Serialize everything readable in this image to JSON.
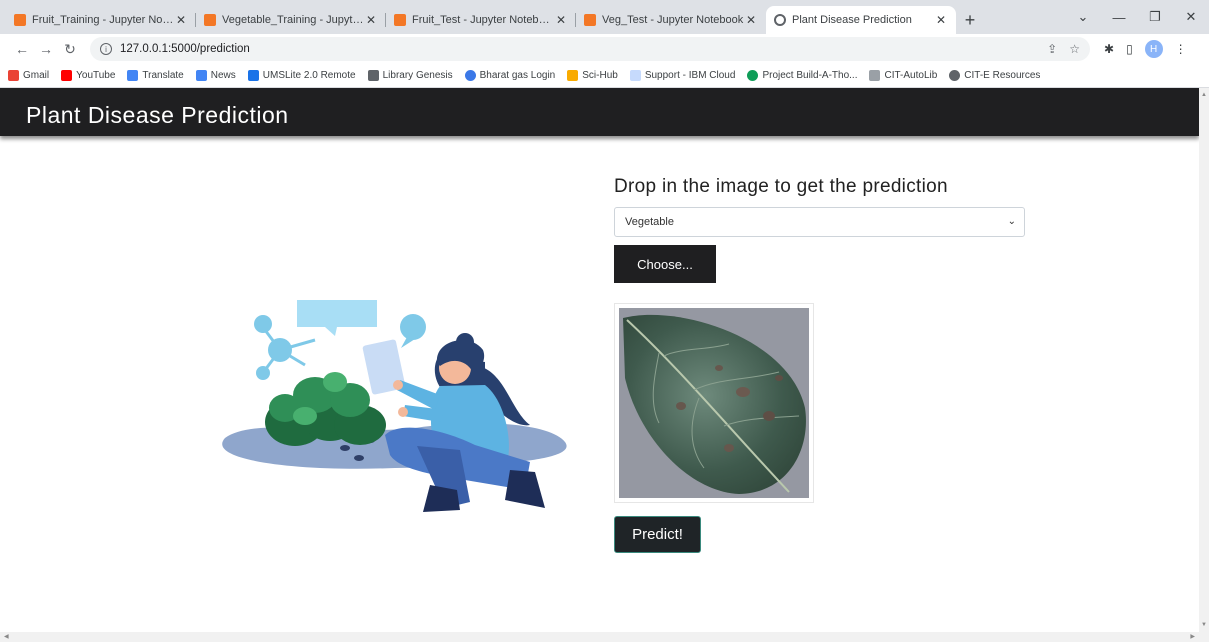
{
  "browser": {
    "tabs": [
      {
        "title": "Fruit_Training - Jupyter Notebook",
        "icon": "jupyter-icon",
        "active": false
      },
      {
        "title": "Vegetable_Training - Jupyter Notebook",
        "icon": "jupyter-icon",
        "active": false
      },
      {
        "title": "Fruit_Test - Jupyter Notebook",
        "icon": "jupyter-icon",
        "active": false
      },
      {
        "title": "Veg_Test - Jupyter Notebook",
        "icon": "jupyter-icon",
        "active": false
      },
      {
        "title": "Plant Disease Prediction",
        "icon": "globe-icon",
        "active": true
      }
    ],
    "url": "127.0.0.1:5000/prediction",
    "profile_initial": "H",
    "bookmarks": [
      {
        "label": "Gmail",
        "color": "#ea4335"
      },
      {
        "label": "YouTube",
        "color": "#ff0000"
      },
      {
        "label": "Translate",
        "color": "#4285f4"
      },
      {
        "label": "News",
        "color": "#4285f4"
      },
      {
        "label": "UMSLite 2.0 Remote",
        "color": "#1a73e8"
      },
      {
        "label": "Library Genesis",
        "color": "#5f6368"
      },
      {
        "label": "Bharat gas Login",
        "color": "#3b78e7"
      },
      {
        "label": "Sci-Hub",
        "color": "#f9ab00"
      },
      {
        "label": "Support - IBM Cloud",
        "color": "#c6dafc"
      },
      {
        "label": "Project Build-A-Tho...",
        "color": "#0f9d58"
      },
      {
        "label": "CIT-AutoLib",
        "color": "#9aa0a6"
      },
      {
        "label": "CIT-E Resources",
        "color": "#5f6368"
      }
    ]
  },
  "page": {
    "title": "Plant Disease Prediction",
    "heading": "Drop in the image to get the prediction",
    "category_select": {
      "selected": "Vegetable"
    },
    "choose_label": "Choose...",
    "predict_label": "Predict!"
  },
  "colors": {
    "header_bg": "#1f1f21",
    "accent_border": "#3a8a7e"
  }
}
